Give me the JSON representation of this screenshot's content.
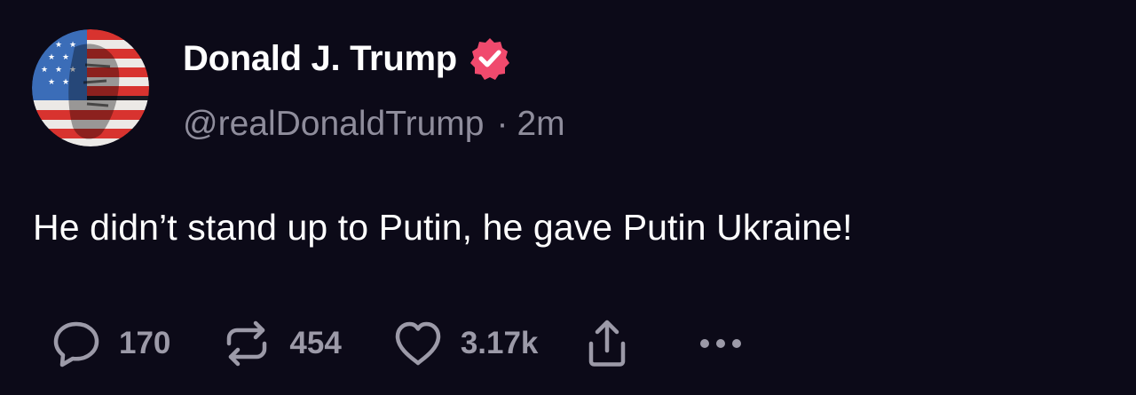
{
  "post": {
    "author": {
      "display_name": "Donald J. Trump",
      "handle": "@realDonaldTrump",
      "verified": true,
      "verified_color": "#f04a6d"
    },
    "separator": "·",
    "timestamp": "2m",
    "text": "He didn’t stand up to Putin, he gave Putin Ukraine!",
    "actions": {
      "reply": {
        "icon": "speech-bubble-icon",
        "count": "170"
      },
      "repost": {
        "icon": "repost-icon",
        "count": "454"
      },
      "like": {
        "icon": "heart-icon",
        "count": "3.17k"
      },
      "share": {
        "icon": "share-icon"
      },
      "more": {
        "icon": "more-icon"
      }
    }
  },
  "colors": {
    "background": "#0c0a18",
    "text_primary": "#ffffff",
    "text_secondary": "#8f8d9c",
    "icon": "#9c9aa8"
  }
}
